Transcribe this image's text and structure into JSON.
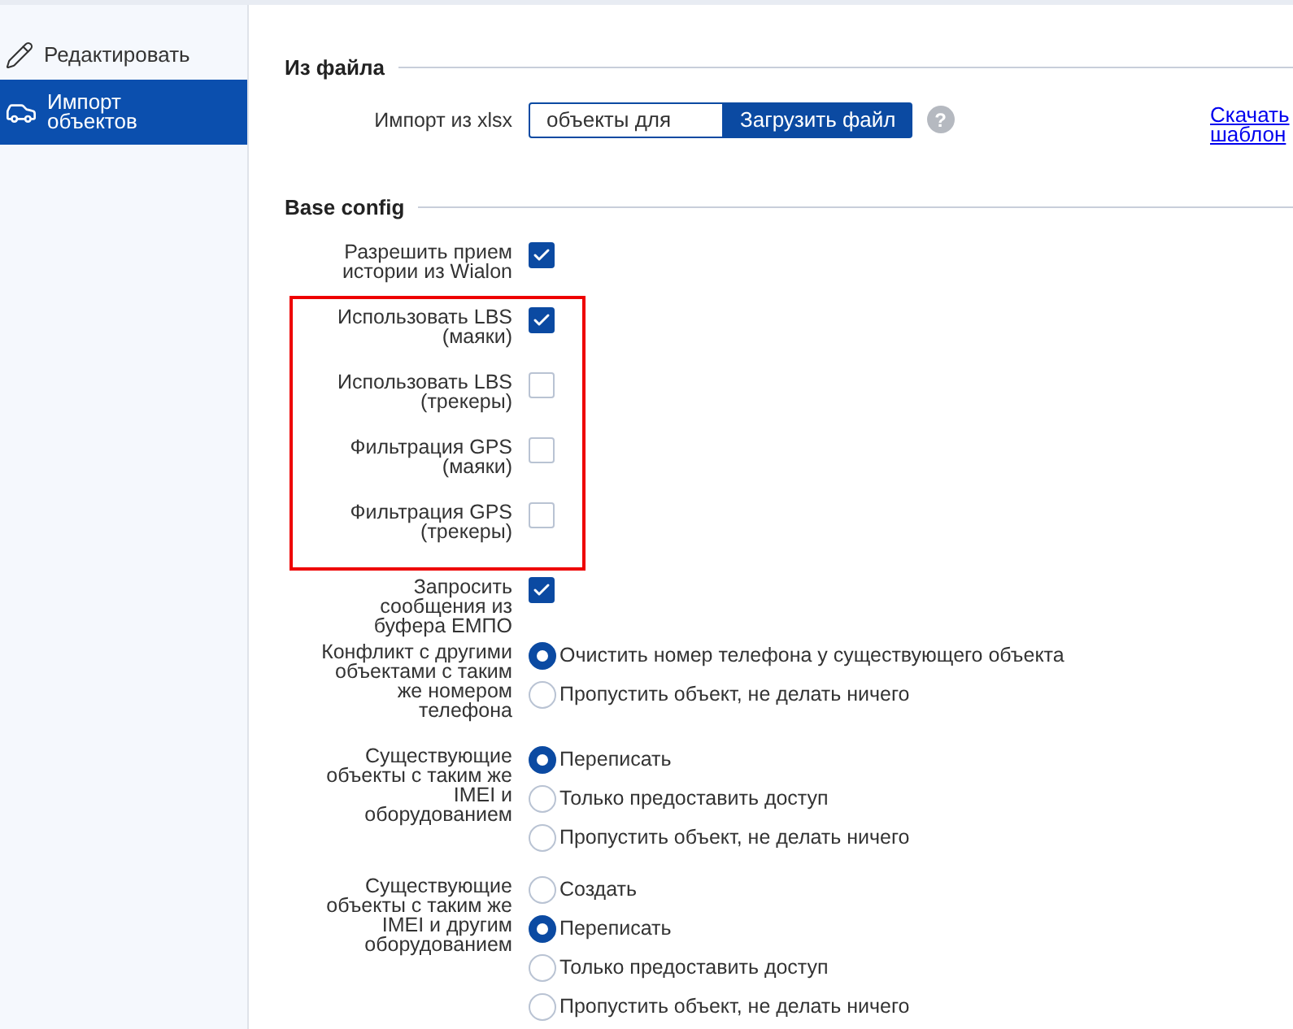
{
  "sidebar": {
    "items": [
      {
        "label": "Редактировать",
        "selected": false
      },
      {
        "label": "Импорт объектов",
        "selected": true
      }
    ]
  },
  "from_file": {
    "title": "Из файла",
    "label": "Импорт из xlsx",
    "field_value": "объекты для",
    "upload_button": "Загрузить файл",
    "help": "?",
    "link": "Скачать шаблон"
  },
  "base_config": {
    "title": "Base config",
    "items": [
      {
        "kind": "checkbox",
        "label": "Разрешить прием истории из Wialon",
        "checked": true
      },
      {
        "kind": "highlight",
        "items": [
          {
            "kind": "checkbox",
            "label": "Использовать LBS (маяки)",
            "checked": true
          },
          {
            "kind": "checkbox",
            "label": "Использовать LBS (трекеры)",
            "checked": false
          },
          {
            "kind": "checkbox",
            "label": "Фильтрация GPS (маяки)",
            "checked": false
          },
          {
            "kind": "checkbox",
            "label": "Фильтрация GPS (трекеры)",
            "checked": false
          }
        ]
      },
      {
        "kind": "checkbox",
        "label": "Запросить сообщения из буфера ЕМПО",
        "checked": true
      },
      {
        "kind": "radio",
        "label": "Конфликт с другими объектами с таким же номером телефона",
        "options": [
          {
            "label": "Очистить номер телефона у существующего объекта",
            "selected": true
          },
          {
            "label": "Пропустить объект, не делать ничего",
            "selected": false
          }
        ]
      },
      {
        "kind": "radio",
        "label": "Существующие объекты с таким же IMEI и оборудованием",
        "options": [
          {
            "label": "Переписать",
            "selected": true
          },
          {
            "label": "Только предоставить доступ",
            "selected": false
          },
          {
            "label": "Пропустить объект, не делать ничего",
            "selected": false
          }
        ]
      },
      {
        "kind": "radio",
        "label": "Существующие объекты с таким же IMEI и другим оборудованием",
        "options": [
          {
            "label": "Создать",
            "selected": false
          },
          {
            "label": "Переписать",
            "selected": true
          },
          {
            "label": "Только предоставить доступ",
            "selected": false
          },
          {
            "label": "Пропустить объект, не делать ничего",
            "selected": false
          }
        ]
      }
    ]
  }
}
